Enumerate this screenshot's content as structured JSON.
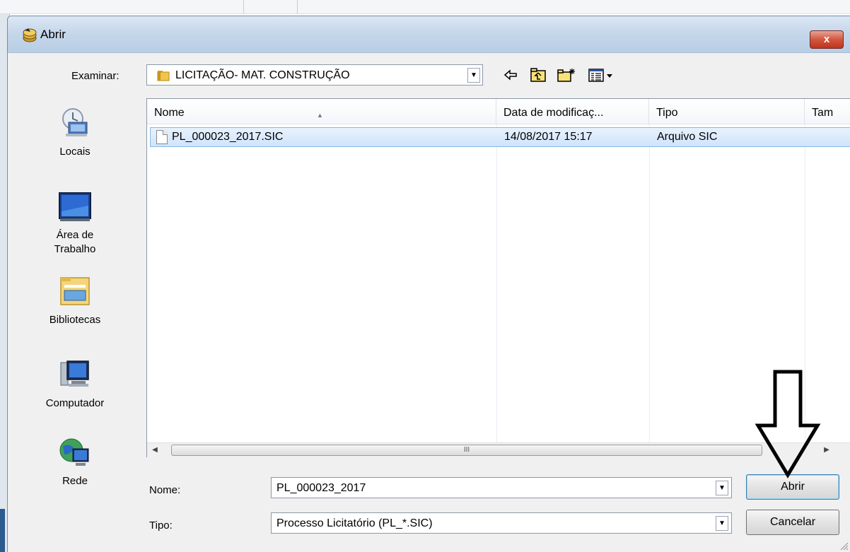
{
  "dialog": {
    "title": "Abrir",
    "close_glyph": "x"
  },
  "toolbar": {
    "look_in_label": "Examinar:",
    "look_in_value": "LICITAÇÃO- MAT. CONSTRUÇÃO",
    "icons": [
      "back-icon",
      "up-folder-icon",
      "new-folder-icon",
      "view-menu-icon"
    ]
  },
  "places": [
    {
      "label": "Locais",
      "icon": "recent-places-icon"
    },
    {
      "label": "Área de Trabalho",
      "icon": "desktop-icon"
    },
    {
      "label": "Bibliotecas",
      "icon": "libraries-icon"
    },
    {
      "label": "Computador",
      "icon": "computer-icon"
    },
    {
      "label": "Rede",
      "icon": "network-icon"
    }
  ],
  "file_list": {
    "columns": [
      "Nome",
      "Data de modificaç...",
      "Tipo",
      "Tam"
    ],
    "rows": [
      {
        "name": "PL_000023_2017.SIC",
        "modified": "14/08/2017 15:17",
        "type": "Arquivo SIC"
      }
    ],
    "scroll_grip": "III"
  },
  "form": {
    "name_label": "Nome:",
    "name_value": "PL_000023_2017",
    "type_label": "Tipo:",
    "type_value": "Processo Licitatório (PL_*.SIC)"
  },
  "buttons": {
    "open": "Abrir",
    "cancel": "Cancelar"
  },
  "colors": {
    "selection": "#cfe4fb",
    "titlebar": "#c4d6ea",
    "close": "#c0341d"
  }
}
